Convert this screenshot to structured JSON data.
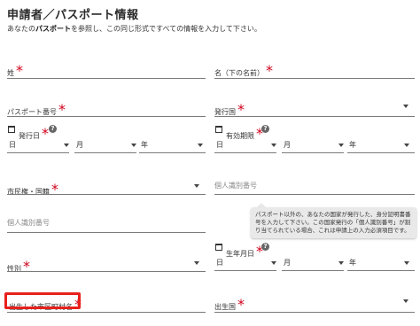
{
  "header": {
    "title": "申請者／パスポート情報",
    "subtitle_pre": "あなたの",
    "subtitle_bold": "パスポート",
    "subtitle_post": "を参照し、この同じ形式ですべての情報を入力して下さい。"
  },
  "fields": {
    "surname": {
      "label": "姓"
    },
    "given_name": {
      "label": "名（下の名前）"
    },
    "passport_number": {
      "label": "パスポート番号"
    },
    "issuing_country": {
      "label": "発行国"
    },
    "issue_date": {
      "label": "発行日",
      "day": "日",
      "month": "月",
      "year": "年"
    },
    "expiry_date": {
      "label": "有効期限",
      "day": "日",
      "month": "月",
      "year": "年"
    },
    "nationality": {
      "label": "市民権・国籍"
    },
    "personal_id_right": {
      "placeholder": "個人識別番号"
    },
    "personal_id_left": {
      "placeholder": "個人識別番号"
    },
    "birth_date": {
      "label": "生年月日",
      "day": "日",
      "month": "月",
      "year": "年"
    },
    "gender": {
      "label": "性別"
    },
    "birth_city": {
      "label": "出生した市区町村名"
    },
    "birth_country": {
      "label": "出生国"
    }
  },
  "tooltip": {
    "text": "パスポート以外の、あなたの国家が発行した、身分証明書番号を入力して下さい。この国家発行の「個人識別番号」が割り当てられている場合、これは申請上の入力必須項目です。"
  },
  "icons": {
    "calendar": "calendar-icon",
    "help": "help-icon",
    "dropdown": "chevron-down-icon"
  },
  "colors": {
    "required": "#d0021b",
    "highlight": "#e8201c"
  }
}
